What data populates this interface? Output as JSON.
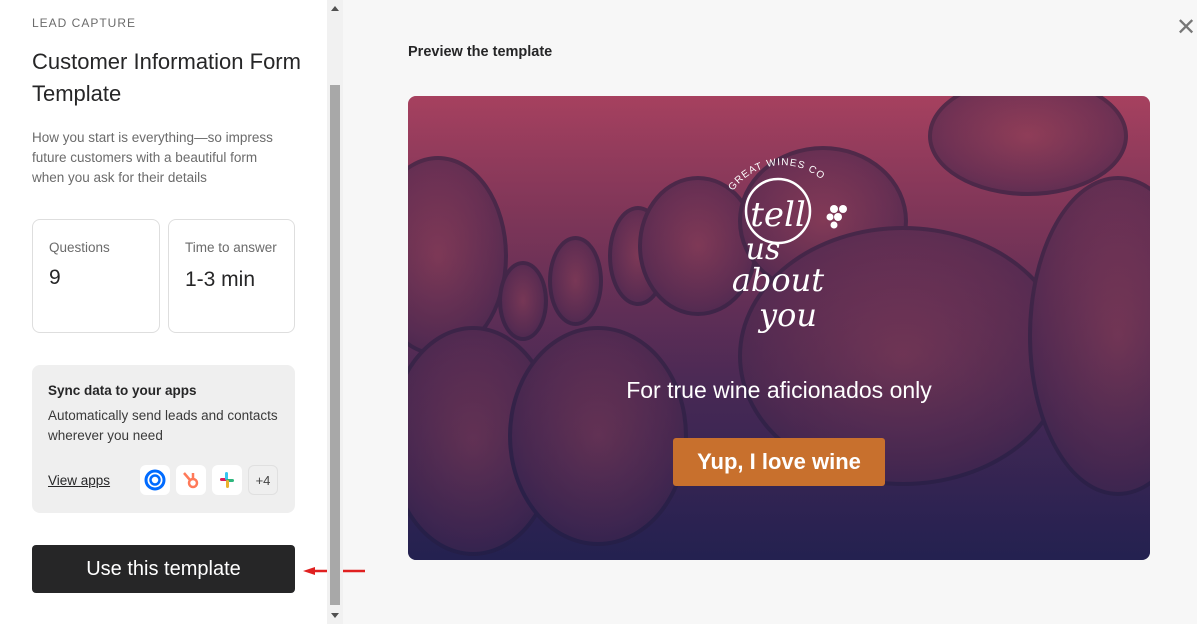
{
  "sidebar": {
    "category": "LEAD CAPTURE",
    "title": "Customer Information Form Template",
    "description": "How you start is everything—so impress future customers with a beautiful form when you ask for their details",
    "stats": [
      {
        "label": "Questions",
        "value": "9"
      },
      {
        "label": "Time to answer",
        "value": "1-3 min"
      }
    ],
    "sync": {
      "title": "Sync data to your apps",
      "text": "Automatically send leads and contacts wherever you need",
      "link": "View apps",
      "apps": [
        "calendly-icon",
        "hubspot-icon",
        "slack-icon"
      ],
      "more": "+4"
    },
    "use_button": "Use this template"
  },
  "main": {
    "heading": "Preview the template",
    "close_icon": "close-icon",
    "preview": {
      "logo_brand": "GREAT WINES CO.",
      "logo_text": "tell us about you",
      "tagline": "For true wine aficionados only",
      "button": "Yup, I love wine",
      "button_color": "#c8702d"
    }
  },
  "annotation": {
    "arrow_color": "#e02020"
  }
}
